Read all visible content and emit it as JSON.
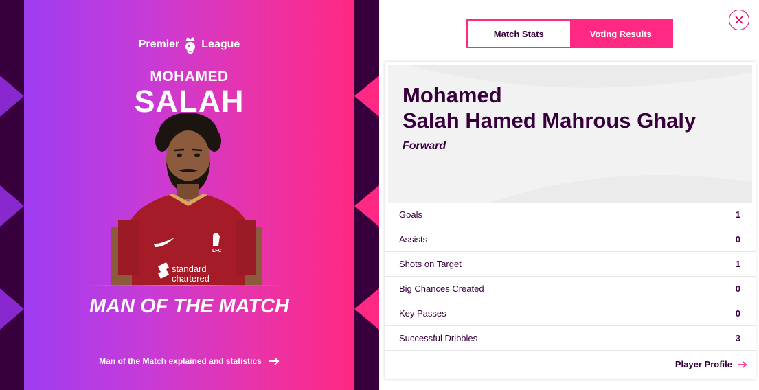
{
  "brand": {
    "logo_prefix": "Premier",
    "logo_suffix": "League",
    "logo_icon": "lion-crown-icon"
  },
  "hero": {
    "first_name": "MOHAMED",
    "last_name": "SALAH",
    "award": "MAN OF THE MATCH",
    "explain_link": "Man of the Match explained and statistics",
    "explain_icon": "arrow-right-icon",
    "shirt_sponsor_line1": "standard",
    "shirt_sponsor_line2": "chartered",
    "shirt_badge": "LFC"
  },
  "tabs": [
    {
      "label": "Match Stats",
      "active": true
    },
    {
      "label": "Voting Results",
      "active": false
    }
  ],
  "player": {
    "name_line1": "Mohamed",
    "name_line2": "Salah Hamed Mahrous Ghaly",
    "position": "Forward"
  },
  "stats": [
    {
      "label": "Goals",
      "value": "1"
    },
    {
      "label": "Assists",
      "value": "0"
    },
    {
      "label": "Shots on Target",
      "value": "1"
    },
    {
      "label": "Big Chances Created",
      "value": "0"
    },
    {
      "label": "Key Passes",
      "value": "0"
    },
    {
      "label": "Successful Dribbles",
      "value": "3"
    }
  ],
  "profile_link": "Player Profile",
  "close_icon": "close-icon",
  "colors": {
    "brand_purple": "#37003c",
    "accent_pink": "#ff2882",
    "close_red": "#e9005a"
  }
}
